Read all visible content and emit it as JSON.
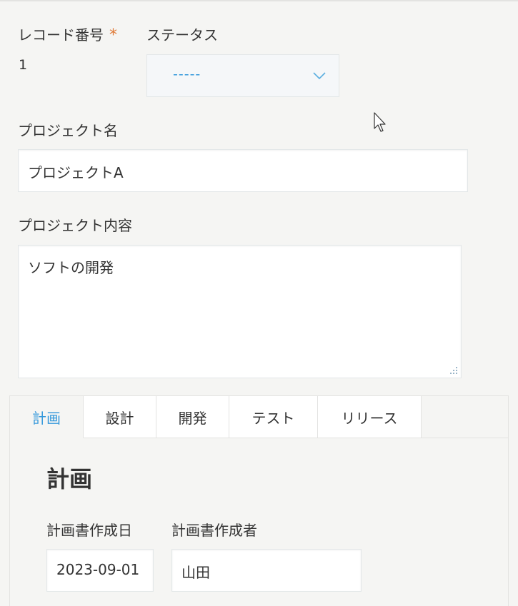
{
  "record": {
    "label": "レコード番号",
    "required_mark": "*",
    "value": "1"
  },
  "status": {
    "label": "ステータス",
    "selected": "-----"
  },
  "project_name": {
    "label": "プロジェクト名",
    "value": "プロジェクトA"
  },
  "project_content": {
    "label": "プロジェクト内容",
    "value": "ソフトの開発"
  },
  "tabs": [
    {
      "label": "計画",
      "active": true
    },
    {
      "label": "設計",
      "active": false
    },
    {
      "label": "開発",
      "active": false
    },
    {
      "label": "テスト",
      "active": false
    },
    {
      "label": "リリース",
      "active": false
    }
  ],
  "plan_section": {
    "title": "計画",
    "created_date": {
      "label": "計画書作成日",
      "value": "2023-09-01"
    },
    "created_by": {
      "label": "計画書作成者",
      "value": "山田"
    }
  },
  "colors": {
    "accent": "#3498db",
    "required": "#e07b39",
    "background": "#f5f5f3"
  }
}
